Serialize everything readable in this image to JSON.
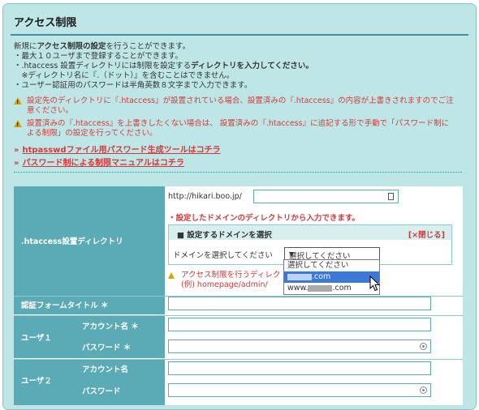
{
  "page": {
    "title": "アクセス制限"
  },
  "intro": {
    "lines": [
      "新規にアクセス制限の設定を行うことができます。",
      "・最大１０ユーザまで登録することができます。",
      "・.htaccess 設置ディレクトリには制限を設定するディレクトリを入力してください。",
      "　※ディレクトリ名に『.（ドット）』を含むことはできません。",
      "・ユーザー認証用のパスワードは半角英数８文字まで入力できます。"
    ]
  },
  "warnings": [
    "設定先のディレクトリに『.htaccess』が設置されている場合、設置済みの『.htaccess』の内容が上書きされますのでご注意ください。",
    "設置済みの『.htaccess』を上書きしたくない場合は、 設置済みの『.htaccess』に追記する形で手動で「パスワード制による制限」の設定を行ってください。"
  ],
  "links": {
    "tool": "htpasswdファイル用パスワード生成ツールはコチラ",
    "manual": "パスワード制による制限マニュアルはコチラ"
  },
  "form": {
    "htaccess_dir_label": ".htaccess設置ディレクトリ",
    "url_prefix": "http://hikari.boo.jp/",
    "dir_value": "",
    "domain_note": "・設定したドメインのディレクトリから入力できます。",
    "domain_box": {
      "heading": "■ 設定するドメインを選択",
      "close_label": "[×閉じる]",
      "prompt": "ドメインを選択してください",
      "selected": "選択してください"
    },
    "dropdown_options": [
      "選択してください",
      ".com",
      "www.",
      ".com"
    ],
    "dir_warning_line1": "アクセス制限を行うディレク",
    "dir_warning_line2": "(例) homepage/admin/",
    "auth_title_label": "認証フォームタイトル ＊",
    "user1_label": "ユーザ１",
    "user2_label": "ユーザ２",
    "account_label_req": "アカウント名 ＊",
    "password_label_req": "パスワード ＊",
    "account_label": "アカウント名",
    "password_label": "パスワード"
  },
  "icons": {
    "warning": "warning-triangle-icon",
    "arrow": "double-chevron-right-icon",
    "eye": "eye-icon",
    "calendar": "calendar-icon",
    "dropdown": "chevron-down-icon",
    "cursor": "mouse-pointer-icon"
  },
  "colors": {
    "panel_bg": "#bfe6e6",
    "label_bg": "#5aabb5",
    "warn_red": "#d33a3a",
    "select_blue": "#3c78d8"
  }
}
